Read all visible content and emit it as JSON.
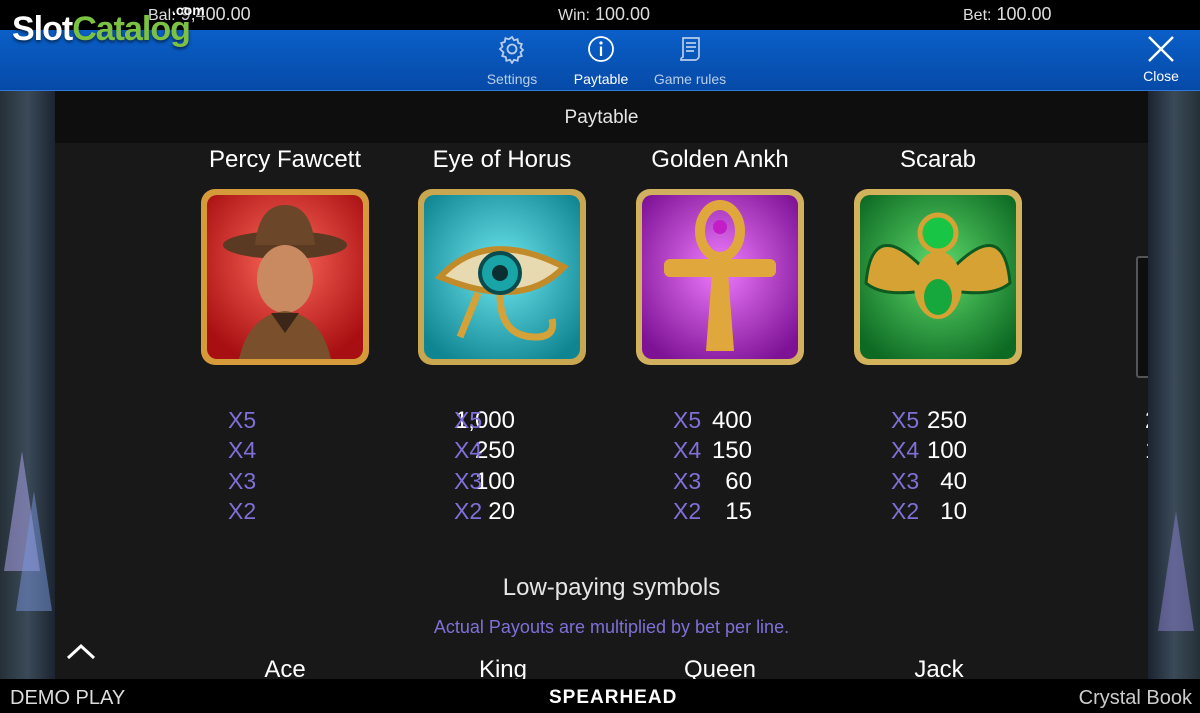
{
  "logo": {
    "part1": "Slot",
    "part2": "Catalog",
    "suffix": ".com"
  },
  "stats": {
    "bal_label": "Bal:",
    "bal_value": "9,400.00",
    "win_label": "Win:",
    "win_value": "100.00",
    "bet_label": "Bet:",
    "bet_value": "100.00"
  },
  "nav": {
    "settings": "Settings",
    "paytable": "Paytable",
    "rules": "Game rules",
    "close": "Close"
  },
  "panel": {
    "title": "Paytable"
  },
  "symbols": [
    {
      "name": "Percy Fawcett",
      "icon": "explorer-icon",
      "color": "#d8201e",
      "pays": [
        {
          "m": "X5",
          "v": "1,000"
        },
        {
          "m": "X4",
          "v": "250"
        },
        {
          "m": "X3",
          "v": "100"
        },
        {
          "m": "X2",
          "v": "20"
        }
      ]
    },
    {
      "name": "Eye of Horus",
      "icon": "eye-of-horus-icon",
      "color": "#1fb3c0",
      "pays": [
        {
          "m": "X5",
          "v": "400"
        },
        {
          "m": "X4",
          "v": "150"
        },
        {
          "m": "X3",
          "v": "60"
        },
        {
          "m": "X2",
          "v": "15"
        }
      ]
    },
    {
      "name": "Golden Ankh",
      "icon": "ankh-icon",
      "color": "#b72ad0",
      "pays": [
        {
          "m": "X5",
          "v": "250"
        },
        {
          "m": "X4",
          "v": "100"
        },
        {
          "m": "X3",
          "v": "40"
        },
        {
          "m": "X2",
          "v": "10"
        }
      ]
    },
    {
      "name": "Scarab",
      "icon": "scarab-icon",
      "color": "#1f9b3a",
      "pays": [
        {
          "m": "X5",
          "v": "250"
        },
        {
          "m": "X4",
          "v": "100"
        },
        {
          "m": "X3",
          "v": "40"
        },
        {
          "m": "X2",
          "v": "10"
        }
      ]
    }
  ],
  "low": {
    "title": "Low-paying symbols",
    "note": "Actual Payouts are multiplied by bet per line.",
    "names": [
      "Ace",
      "King",
      "Queen",
      "Jack"
    ]
  },
  "footer": {
    "demo": "DEMO PLAY",
    "brand": "SPEARHEAD",
    "game": "Crystal Book"
  }
}
